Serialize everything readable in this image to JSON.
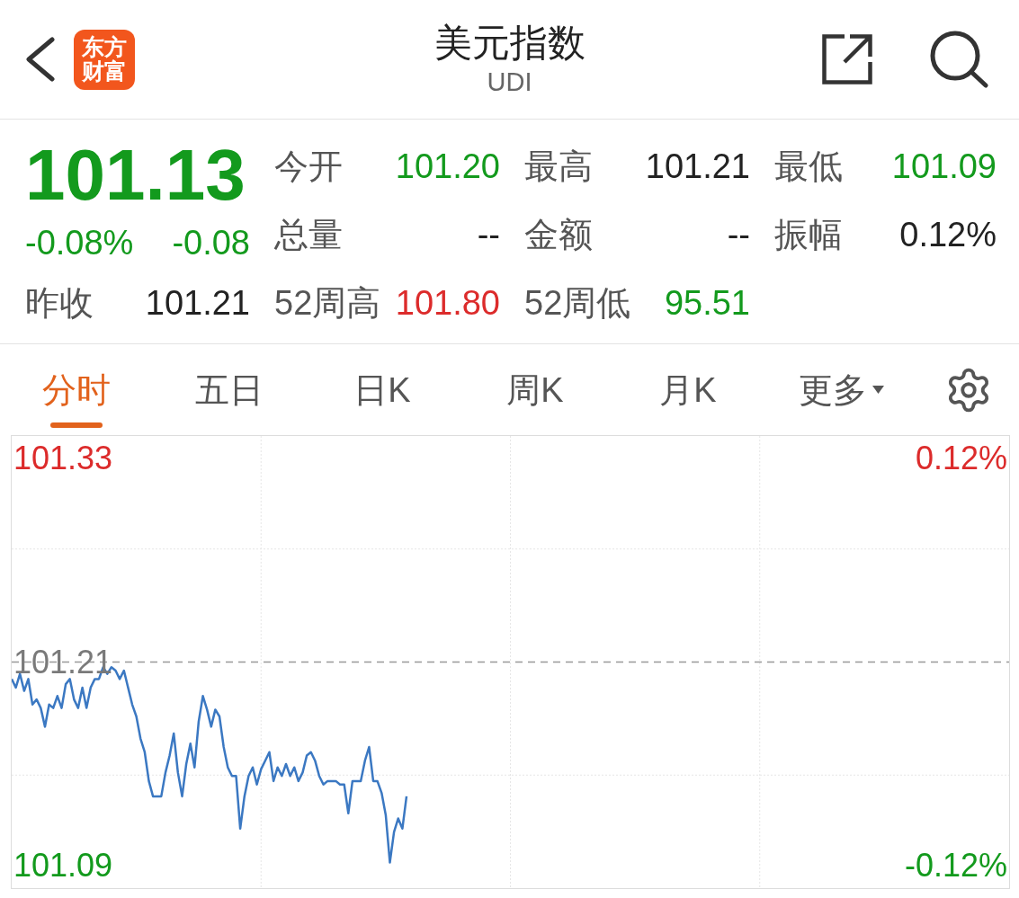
{
  "header": {
    "logo_text": "东方财富",
    "title": "美元指数",
    "subtitle": "UDI"
  },
  "quote": {
    "price": "101.13",
    "change_percent": "-0.08%",
    "change": "-0.08",
    "color": "#139a1d",
    "stats_rows": [
      [
        {
          "label": "今开",
          "value": "101.20",
          "color": "#139a1d"
        },
        {
          "label": "最高",
          "value": "101.21",
          "color": "#222222"
        },
        {
          "label": "最低",
          "value": "101.09",
          "color": "#139a1d"
        }
      ],
      [
        {
          "label": "总量",
          "value": "--",
          "color": "#222222"
        },
        {
          "label": "金额",
          "value": "--",
          "color": "#222222"
        },
        {
          "label": "振幅",
          "value": "0.12%",
          "color": "#222222"
        }
      ],
      [
        {
          "label": "昨收",
          "value": "101.21",
          "color": "#222222"
        },
        {
          "label": "52周高",
          "value": "101.80",
          "color": "#dc2b2b"
        },
        {
          "label": "52周低",
          "value": "95.51",
          "color": "#139a1d"
        }
      ]
    ]
  },
  "tabs": [
    {
      "label": "分时",
      "selected": true,
      "kind": "tab"
    },
    {
      "label": "五日",
      "selected": false,
      "kind": "tab"
    },
    {
      "label": "日K",
      "selected": false,
      "kind": "tab"
    },
    {
      "label": "周K",
      "selected": false,
      "kind": "tab"
    },
    {
      "label": "月K",
      "selected": false,
      "kind": "tab"
    },
    {
      "label": "更多",
      "selected": false,
      "kind": "menu"
    }
  ],
  "chart": {
    "chart_data": {
      "type": "line",
      "ylim": [
        101.077,
        101.343
      ],
      "yticks": [
        {
          "value": 101.33,
          "label": "101.33"
        },
        {
          "value": 101.21,
          "label": "101.21"
        },
        {
          "value": 101.09,
          "label": "101.09"
        }
      ],
      "ref_lines": [
        {
          "axis": "y",
          "value": 101.21
        }
      ],
      "series": [
        {
          "color": "#3b78c2",
          "values": [
            101.2,
            101.195,
            101.203,
            101.193,
            101.2,
            101.185,
            101.188,
            101.183,
            101.172,
            101.185,
            101.183,
            101.19,
            101.183,
            101.197,
            101.2,
            101.188,
            101.183,
            101.195,
            101.183,
            101.195,
            101.2,
            101.2,
            101.207,
            101.203,
            101.207,
            101.205,
            101.2,
            101.205,
            101.195,
            101.185,
            101.178,
            101.165,
            101.157,
            101.14,
            101.131,
            101.131,
            101.131,
            101.145,
            101.155,
            101.168,
            101.145,
            101.131,
            101.15,
            101.162,
            101.148,
            101.175,
            101.19,
            101.182,
            101.172,
            101.182,
            101.178,
            101.16,
            101.148,
            101.143,
            101.143,
            101.112,
            101.131,
            101.143,
            101.148,
            101.138,
            101.147,
            101.152,
            101.157,
            101.14,
            101.148,
            101.143,
            101.15,
            101.143,
            101.148,
            101.14,
            101.145,
            101.155,
            101.157,
            101.152,
            101.143,
            101.138,
            101.14,
            101.14,
            101.14,
            101.138,
            101.138,
            101.121,
            101.14,
            101.14,
            101.14,
            101.152,
            101.16,
            101.14,
            101.14,
            101.133,
            101.12,
            101.092,
            101.11,
            101.118,
            101.112,
            101.131,
            null,
            null,
            null,
            null,
            null,
            null,
            null,
            null,
            null,
            null,
            null,
            null,
            null,
            null,
            null,
            null,
            null,
            null,
            null,
            null,
            null,
            null,
            null,
            null,
            null,
            null,
            null,
            null,
            null,
            null,
            null,
            null,
            null,
            null,
            null,
            null,
            null,
            null,
            null,
            null,
            null,
            null,
            null,
            null,
            null,
            null,
            null,
            null,
            null,
            null,
            null,
            null,
            null,
            null,
            null,
            null,
            null,
            null,
            null,
            null,
            null,
            null,
            null,
            null,
            null,
            null,
            null,
            null,
            null,
            null,
            null,
            null,
            null,
            null,
            null,
            null,
            null,
            null,
            null,
            null,
            null,
            null,
            null,
            null,
            null,
            null,
            null,
            null,
            null,
            null,
            null,
            null,
            null,
            null,
            null,
            null,
            null,
            null,
            null,
            null,
            null,
            null,
            null,
            null,
            null,
            null,
            null,
            null,
            null,
            null,
            null,
            null,
            null,
            null,
            null,
            null,
            null,
            null,
            null,
            null,
            null,
            null,
            null,
            null,
            null,
            null,
            null,
            null,
            null,
            null,
            null,
            null,
            null,
            null,
            null,
            null,
            null,
            null,
            null,
            null,
            null,
            null,
            null,
            null,
            null
          ]
        }
      ]
    },
    "right_labels": [
      {
        "label": "0.12%",
        "color": "#dc2b2b"
      },
      {
        "label": "-0.12%",
        "color": "#139a1d"
      }
    ]
  }
}
